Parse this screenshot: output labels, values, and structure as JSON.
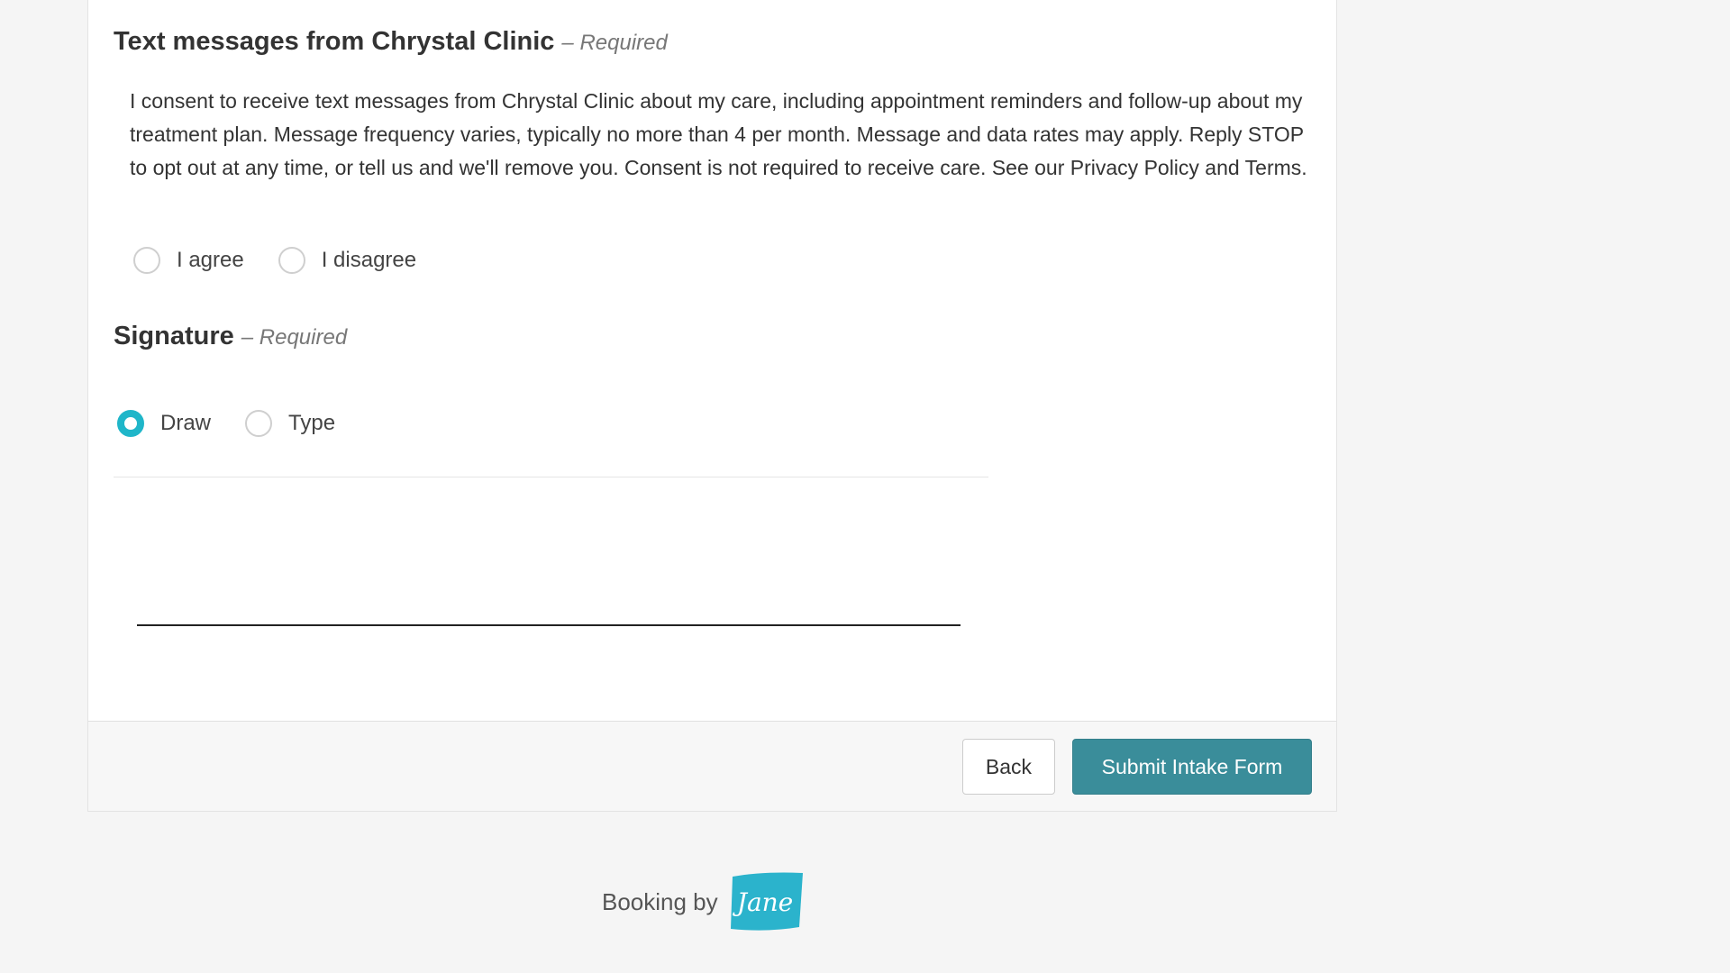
{
  "sms_consent": {
    "heading": "Text messages from Chrystal Clinic",
    "required_note": "– Required",
    "body": "I consent to receive text messages from Chrystal Clinic about my care, including appointment reminders and follow-up about my treatment plan. Message frequency varies, typically no more than 4 per month. Message and data rates may apply. Reply STOP to opt out at any time, or tell us and we'll remove you. Consent is not required to receive care. See our Privacy Policy and Terms.",
    "options": [
      {
        "label": "I agree",
        "selected": false
      },
      {
        "label": "I disagree",
        "selected": false
      }
    ]
  },
  "signature": {
    "heading": "Signature",
    "required_note": "– Required",
    "modes": [
      {
        "label": "Draw",
        "selected": true
      },
      {
        "label": "Type",
        "selected": false
      }
    ]
  },
  "footer": {
    "back_label": "Back",
    "submit_label": "Submit Intake Form"
  },
  "branding": {
    "text": "Booking by",
    "logo_text": "Jane"
  },
  "colors": {
    "accent": "#1fb6c9",
    "submit": "#3a8d9a",
    "logo": "#2bb3cc"
  }
}
